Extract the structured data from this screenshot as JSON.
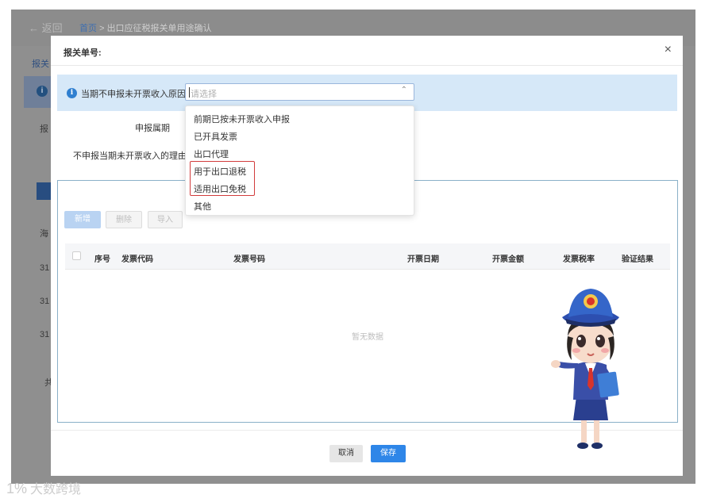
{
  "background": {
    "back_label": "返回",
    "breadcrumb": {
      "home": "首页",
      "separator": ">",
      "current": "出口应征税报关单用途确认"
    },
    "tab_label": "报关",
    "info_icon": "info-icon",
    "side_texts": [
      "报",
      "海",
      "31",
      "31",
      "31",
      "共"
    ]
  },
  "modal": {
    "title": "报关单号:",
    "close_icon": "close-icon",
    "notice": {
      "icon": "info-icon",
      "label": "当期不申报未开票收入原因",
      "select_placeholder": "请选择"
    },
    "fields": {
      "period_label": "申报属期",
      "reason_label": "不申报当期未开票收入的理由"
    },
    "dropdown": {
      "options": [
        "前期已按未开票收入申报",
        "已开具发票",
        "出口代理",
        "用于出口退税",
        "适用出口免税",
        "其他"
      ],
      "highlight_color": "#d23c3c"
    },
    "toolbar": {
      "new_label": "新增",
      "delete_label": "删除",
      "import_label": "导入"
    },
    "table": {
      "columns": [
        "序号",
        "发票代码",
        "发票号码",
        "开票日期",
        "开票金额",
        "发票税率",
        "验证结果"
      ],
      "rows": [],
      "empty_text": "暂无数据"
    },
    "footer": {
      "cancel_label": "取消",
      "save_label": "保存"
    }
  },
  "watermark": {
    "logo": "1%",
    "text": "大数跨境"
  },
  "colors": {
    "primary": "#2e86e8",
    "notice_bg": "#d6e8f8",
    "highlight": "#d23c3c"
  }
}
